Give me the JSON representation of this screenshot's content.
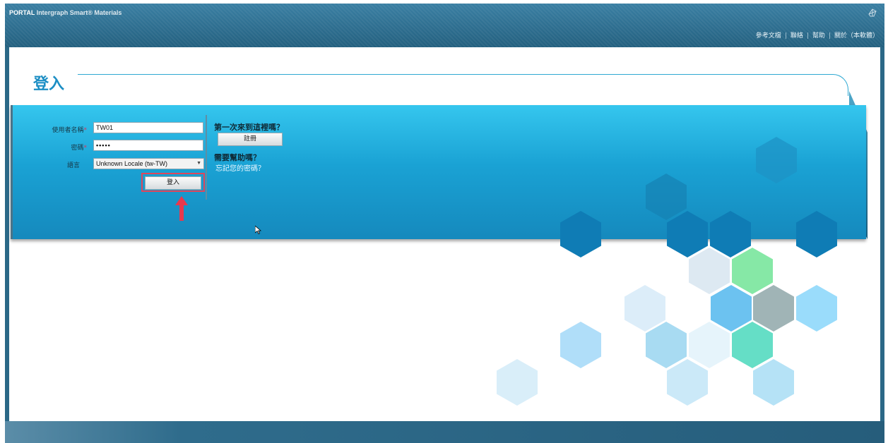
{
  "header": {
    "brand_portal": "PORTAL",
    "brand_product": "Intergraph Smart® Materials",
    "corner_icon": "app-logo-icon",
    "links": [
      {
        "label": "參考文檔"
      },
      {
        "label": "聯絡"
      },
      {
        "label": "幫助"
      },
      {
        "label": "關於（本軟體）"
      }
    ]
  },
  "page": {
    "title": "登入"
  },
  "login_form": {
    "username_label": "使用者名稱",
    "username_value": "TW01",
    "password_label": "密碼",
    "password_value": "•••••",
    "required_mark": "*",
    "language_label": "語言",
    "language_value": "Unknown Locale (tw-TW)",
    "login_button": "登入"
  },
  "sidebar_help": {
    "first_time_heading": "第一次來到這裡嗎？",
    "register_button": "註冊",
    "need_help_heading": "需要幫助嗎？",
    "forgot_password_link": "忘記您的密碼？"
  },
  "colors": {
    "accent": "#1c8ec4",
    "panel_top": "#35c6ee",
    "panel_bottom": "#1589bd",
    "highlight_outline": "#e0465b",
    "header": "#2b6887"
  }
}
